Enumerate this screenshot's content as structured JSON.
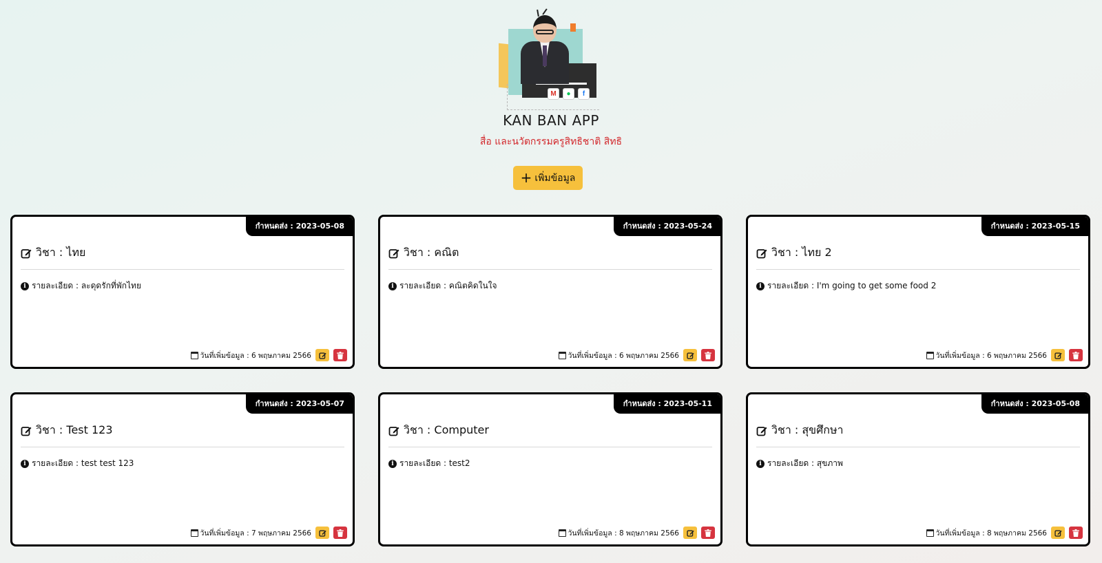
{
  "header": {
    "title": "KAN BAN APP",
    "subtitle": "สื่อ และนวัตกรรมครูสิทธิชาติ สิทธิ",
    "social_icons": [
      {
        "icon": "gmail-icon",
        "glyph": "M",
        "color": "#d93025"
      },
      {
        "icon": "line-icon",
        "glyph": "●",
        "color": "#06c755"
      },
      {
        "icon": "facebook-icon",
        "glyph": "f",
        "color": "#1877f2"
      }
    ]
  },
  "add_button": {
    "label": "เพิ่มข้อมูล",
    "icon": "plus-icon"
  },
  "colors": {
    "accent": "#f6c03c",
    "danger": "#d6343f",
    "subtitle": "#d2282c",
    "card_border": "#000000"
  },
  "cards": [
    {
      "deadline": "กำหนดส่ง : 2023-05-08",
      "title": "วิชา : ไทย",
      "detail": "รายละเอียด : ละดุดรักที่พักไทย",
      "added": "วันที่เพิ่มข้อมูล : 6 พฤษภาคม 2566"
    },
    {
      "deadline": "กำหนดส่ง : 2023-05-24",
      "title": "วิชา : คณิต",
      "detail": "รายละเอียด : คณิตคิดในใจ",
      "added": "วันที่เพิ่มข้อมูล : 6 พฤษภาคม 2566"
    },
    {
      "deadline": "กำหนดส่ง : 2023-05-15",
      "title": "วิชา : ไทย 2",
      "detail": "รายละเอียด : I'm going to get some food 2",
      "added": "วันที่เพิ่มข้อมูล : 6 พฤษภาคม 2566"
    },
    {
      "deadline": "กำหนดส่ง : 2023-05-07",
      "title": "วิชา : Test 123",
      "detail": "รายละเอียด : test test 123",
      "added": "วันที่เพิ่มข้อมูล : 7 พฤษภาคม 2566"
    },
    {
      "deadline": "กำหนดส่ง : 2023-05-11",
      "title": "วิชา : Computer",
      "detail": "รายละเอียด : test2",
      "added": "วันที่เพิ่มข้อมูล : 8 พฤษภาคม 2566"
    },
    {
      "deadline": "กำหนดส่ง : 2023-05-08",
      "title": "วิชา : สุขศึกษา",
      "detail": "รายละเอียด : สุขภาพ",
      "added": "วันที่เพิ่มข้อมูล : 8 พฤษภาคม 2566"
    }
  ]
}
